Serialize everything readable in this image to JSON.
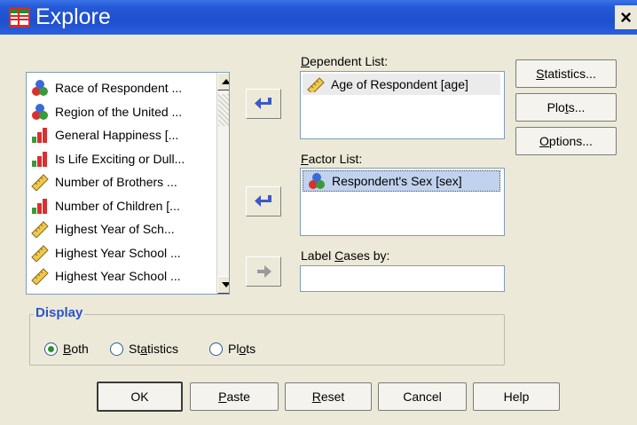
{
  "window": {
    "title": "Explore",
    "close_glyph": "×"
  },
  "variables": {
    "items": [
      {
        "label": "Race of Respondent ...",
        "icon": "nominal-icon"
      },
      {
        "label": "Region of the United ...",
        "icon": "nominal-icon"
      },
      {
        "label": "General Happiness [...",
        "icon": "ordinal-icon"
      },
      {
        "label": "Is Life Exciting or Dull...",
        "icon": "ordinal-icon"
      },
      {
        "label": "Number of Brothers ...",
        "icon": "scale-icon"
      },
      {
        "label": "Number of Children [...",
        "icon": "ordinal-icon"
      },
      {
        "label": "Highest Year of Sch...",
        "icon": "scale-icon"
      },
      {
        "label": "Highest Year School ...",
        "icon": "scale-icon"
      },
      {
        "label": "Highest Year School ...",
        "icon": "scale-icon"
      }
    ]
  },
  "dependent": {
    "label_u": "D",
    "label_rest": "ependent List:",
    "items": [
      {
        "label": "Age of Respondent [age]",
        "icon": "scale-icon"
      }
    ]
  },
  "factor": {
    "label_u": "F",
    "label_rest": "actor List:",
    "items": [
      {
        "label": "Respondent's Sex [sex]",
        "icon": "nominal-icon"
      }
    ]
  },
  "label_cases": {
    "label_pre": "Label ",
    "label_u": "C",
    "label_rest": "ases by:",
    "value": ""
  },
  "side_buttons": {
    "statistics": {
      "pre": "",
      "u": "S",
      "rest": "tatistics..."
    },
    "plots": {
      "pre": "Plo",
      "u": "t",
      "rest": "s..."
    },
    "options": {
      "pre": "",
      "u": "O",
      "rest": "ptions..."
    }
  },
  "display": {
    "title": "Display",
    "selected": "Both",
    "options": [
      {
        "pre": "",
        "u": "B",
        "rest": "oth"
      },
      {
        "pre": "St",
        "u": "a",
        "rest": "tistics"
      },
      {
        "pre": "Pl",
        "u": "o",
        "rest": "ts"
      }
    ]
  },
  "bottom_buttons": {
    "ok": "OK",
    "paste": {
      "u": "P",
      "rest": "aste"
    },
    "reset": {
      "u": "R",
      "rest": "eset"
    },
    "cancel": "Cancel",
    "help": "Help"
  },
  "colors": {
    "title_bar": "#1f4fcc",
    "group_title": "#2b55c8",
    "selection": "#c1d2ee"
  }
}
